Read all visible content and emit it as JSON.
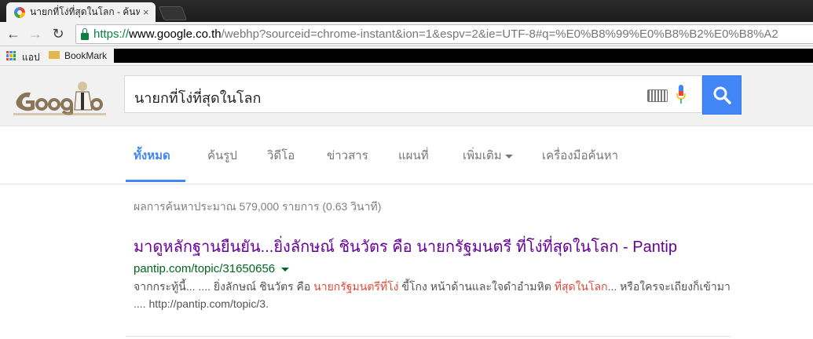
{
  "browser": {
    "tab_title": "นายกที่โง่ที่สุดในโลก - ค้นหาด้",
    "tab_close": "×",
    "url_scheme": "https://",
    "url_host": "www.google.co.th",
    "url_rest": "/webhp?sourceid=chrome-instant&ion=1&espv=2&ie=UTF-8#q=%E0%B8%99%E0%B8%B2%E0%B8%A2",
    "bookmarks": {
      "apps_label": "แอป",
      "folder_label": "BookMark"
    }
  },
  "search": {
    "query": "นายกที่โง่ที่สุดในโลก"
  },
  "tabs": [
    {
      "label": "ทั้งหมด"
    },
    {
      "label": "ค้นรูป"
    },
    {
      "label": "วิดีโอ"
    },
    {
      "label": "ข่าวสาร"
    },
    {
      "label": "แผนที่"
    },
    {
      "label": "เพิ่มเติม"
    },
    {
      "label": "เครื่องมือค้นหา"
    }
  ],
  "stats": "ผลการค้นหาประมาณ 579,000 รายการ (0.63 วินาที)",
  "results": [
    {
      "title": "มาดูหลักฐานยืนยัน...ยิ่งลักษณ์ ชินวัตร คือ นายกรัฐมนตรี ที่โง่ที่สุดในโลก - Pantip",
      "url": "pantip.com/topic/31650656",
      "snippet": {
        "part1": "จากกระทู้นี้... .... ยิ่งลักษณ์ ชินวัตร คือ ",
        "em1": "นายกรัฐมนตรีที่โง่",
        "part2": " ขี้โกง หน้าด้านและใจดำอำมหิต ",
        "em2": "ที่สุดในโลก",
        "part3": "... หรือใครจะเถียงก็เข้ามา .... http://pantip.com/topic/3."
      }
    }
  ],
  "colors": {
    "accent": "#4285f4",
    "visited_title": "#660099",
    "url_green": "#006621",
    "highlight": "#dd4b39"
  }
}
